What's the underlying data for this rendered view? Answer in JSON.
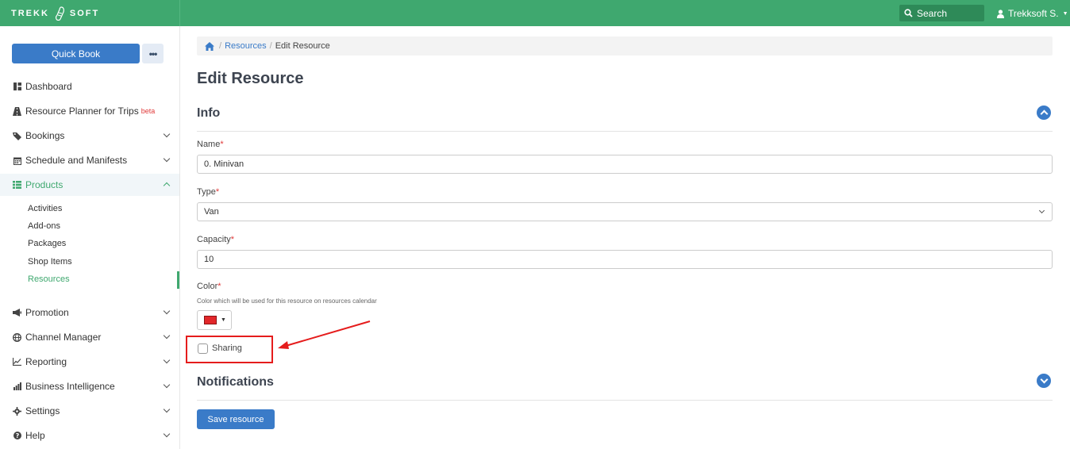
{
  "header": {
    "brand_left": "TREKK",
    "brand_right": "SOFT",
    "search_label": "Search",
    "user_label": "Trekksoft S."
  },
  "sidebar": {
    "quickbook_label": "Quick Book",
    "more_label": "•••",
    "items": [
      {
        "label": "Dashboard",
        "icon": "dashboard-icon"
      },
      {
        "label": "Resource Planner for Trips",
        "badge": "beta",
        "icon": "road-icon"
      },
      {
        "label": "Bookings",
        "icon": "tag-icon"
      },
      {
        "label": "Schedule and Manifests",
        "icon": "calendar-icon"
      },
      {
        "label": "Products",
        "icon": "list-icon"
      },
      {
        "label": "Promotion",
        "icon": "megaphone-icon"
      },
      {
        "label": "Channel Manager",
        "icon": "globe-icon"
      },
      {
        "label": "Reporting",
        "icon": "line-chart-icon"
      },
      {
        "label": "Business Intelligence",
        "icon": "bar-chart-icon"
      },
      {
        "label": "Settings",
        "icon": "gear-icon"
      },
      {
        "label": "Help",
        "icon": "question-icon"
      }
    ],
    "sub_items": [
      "Activities",
      "Add-ons",
      "Packages",
      "Shop Items",
      "Resources"
    ]
  },
  "breadcrumb": {
    "items": [
      "Resources",
      "Edit Resource"
    ]
  },
  "page": {
    "title": "Edit Resource",
    "info_title": "Info",
    "notifications_title": "Notifications"
  },
  "form": {
    "name_label": "Name",
    "name_value": "0. Minivan",
    "type_label": "Type",
    "type_value": "Van",
    "capacity_label": "Capacity",
    "capacity_value": "10",
    "color_label": "Color",
    "color_hint": "Color which will be used for this resource on resources calendar",
    "color_value": "#e2272a",
    "sharing_label": "Sharing",
    "required_mark": "*",
    "save_label": "Save resource"
  },
  "colors": {
    "brand_green": "#3fa86f",
    "primary_blue": "#3a7bc8",
    "highlight_red": "#e51c1c"
  }
}
